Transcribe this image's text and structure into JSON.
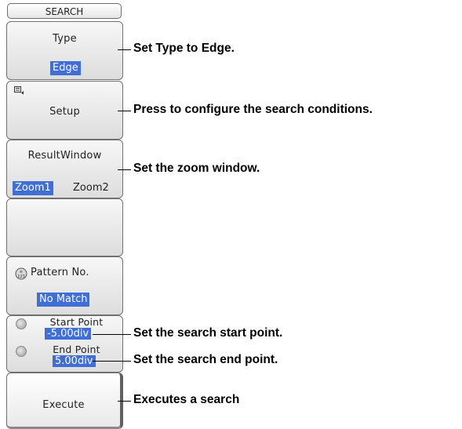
{
  "menu": {
    "title": "SEARCH"
  },
  "keys": {
    "type": {
      "label": "Type",
      "value": "Edge"
    },
    "setup": {
      "label": "Setup",
      "icon": "list-setup-icon"
    },
    "result_window": {
      "label": "ResultWindow",
      "options": [
        "Zoom1",
        "Zoom2"
      ],
      "selected": "Zoom1"
    },
    "empty": {},
    "pattern": {
      "label": "Pattern No.",
      "value": "No Match",
      "icon": "numeric-keypad-icon"
    },
    "start": {
      "label": "Start Point",
      "value": "-5.00div"
    },
    "end": {
      "label": "End Point",
      "value": "5.00div"
    },
    "execute": {
      "label": "Execute"
    }
  },
  "callouts": {
    "type": "Set Type to Edge.",
    "setup": "Press to configure the search conditions.",
    "zoom": "Set the zoom window.",
    "start": "Set the search start point.",
    "end": "Set the search end point.",
    "execute": "Executes a search"
  }
}
